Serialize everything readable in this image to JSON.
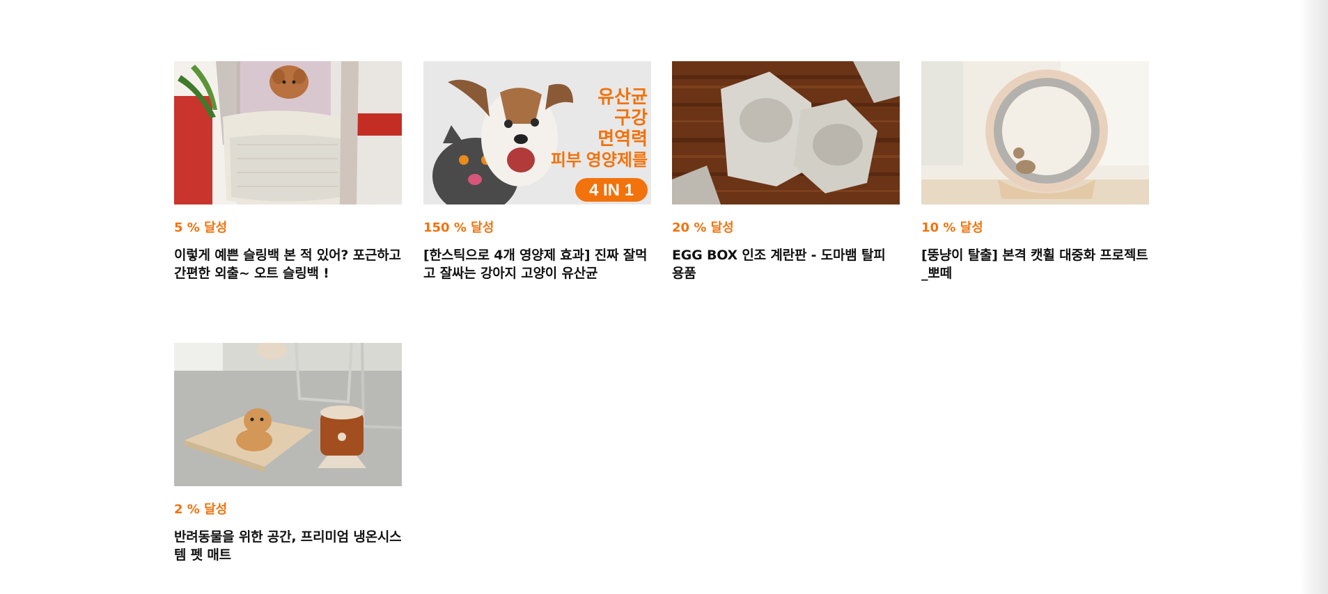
{
  "projects": [
    {
      "achievement": "5 % 달성",
      "title": "이렇게 예쁜 슬링백 본 적 있어? 포근하고 간편한 외출~ 오트 슬링백 !",
      "image_icon": "sling-bag-dog-photo"
    },
    {
      "achievement": "150 % 달성",
      "title": "[한스틱으로 4개 영양제 효과] 진짜 잘먹고 잘싸는 강아지 고양이 유산균",
      "image_icon": "dog-cat-supplement-ad",
      "image_text": {
        "line1": "유산균",
        "line2": "구강",
        "line3": "면역력",
        "line4": "피부 영양제를",
        "badge": "4 IN 1"
      }
    },
    {
      "achievement": "20 % 달성",
      "title": "EGG BOX 인조 계란판 - 도마뱀 탈피 용품",
      "image_icon": "egg-box-hide-photo"
    },
    {
      "achievement": "10 % 달성",
      "title": "[뚱냥이 탈출] 본격 캣휠 대중화 프로젝트 _뽀떼",
      "image_icon": "cat-wheel-photo"
    },
    {
      "achievement": "2 % 달성",
      "title": "반려동물을 위한 공간, 프리미엄 냉온시스템 펫 매트",
      "image_icon": "pet-mat-heater-photo"
    }
  ],
  "colors": {
    "accent": "#f2720c",
    "title": "#111111",
    "background": "#ffffff"
  }
}
